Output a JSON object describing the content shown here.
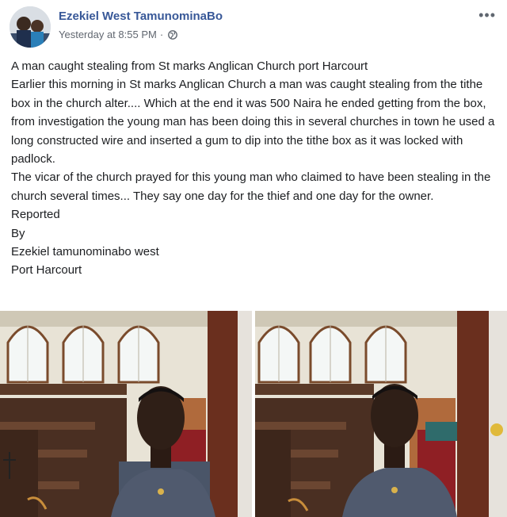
{
  "post": {
    "author": "Ezekiel West TamunominaBo",
    "timestamp": "Yesterday at 8:55 PM",
    "separator": "·",
    "more_label": "•••",
    "privacy_icon": "globe-icon",
    "paragraphs": [
      "A man caught stealing from St marks Anglican Church port Harcourt",
      "Earlier this morning in St marks Anglican Church a man was caught stealing from the tithe box in the church alter.... Which at the end it was 500 Naira he ended getting from the box, from investigation the young man has been doing this in several churches in town he used a long constructed wire and inserted a gum to dip into the tithe box as it was locked with padlock.",
      "The vicar of the church prayed for this young man who claimed to have been stealing in the church several times... They say one day for the thief and one day for the owner.",
      "Reported",
      "By",
      "Ezekiel tamunominabo west",
      "Port Harcourt"
    ]
  },
  "colors": {
    "author_link": "#385898",
    "meta_text": "#616770",
    "body_text": "#1c1e21"
  }
}
